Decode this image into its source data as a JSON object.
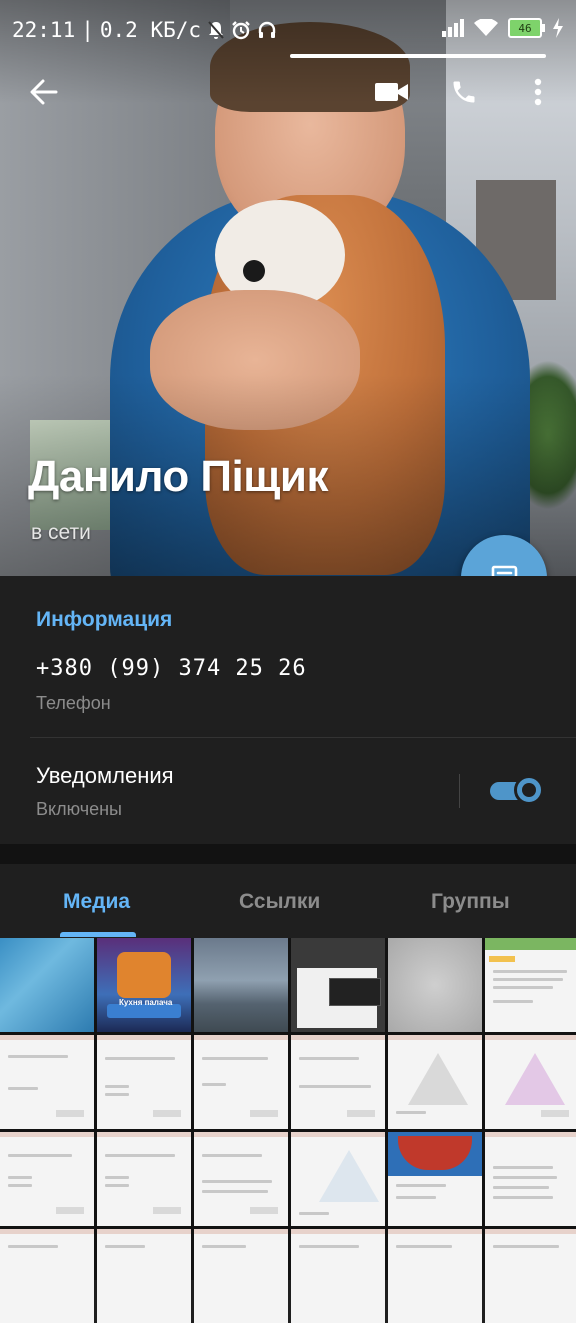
{
  "status_bar": {
    "time": "22:11",
    "separator": "|",
    "speed": "0.2 КБ/с",
    "battery": "46",
    "icons": [
      "mute-bell-icon",
      "alarm-icon",
      "headphones-icon",
      "signal-icon",
      "wifi-icon",
      "battery-icon",
      "charging-icon"
    ]
  },
  "toolbar": {
    "back_icon": "arrow-left-icon",
    "video_icon": "video-call-icon",
    "call_icon": "phone-icon",
    "menu_icon": "more-vert-icon"
  },
  "profile": {
    "name": "Данило Піщик",
    "presence": "в сети"
  },
  "fab_icon": "message-icon",
  "info": {
    "title": "Информация",
    "phone": "+380 (99) 374 25 26",
    "phone_label": "Телефон",
    "notifications_label": "Уведомления",
    "notifications_state": "Включены",
    "notifications_enabled": true
  },
  "tabs": [
    {
      "label": "Медиа",
      "active": true
    },
    {
      "label": "Ссылки",
      "active": false
    },
    {
      "label": "Группы",
      "active": false
    }
  ],
  "game_thumb_caption": "Кухня палача",
  "colors": {
    "accent": "#64b5f6",
    "fab": "#5ba4d8",
    "background": "#1f1f1f",
    "toggle": "#4e95c9"
  }
}
